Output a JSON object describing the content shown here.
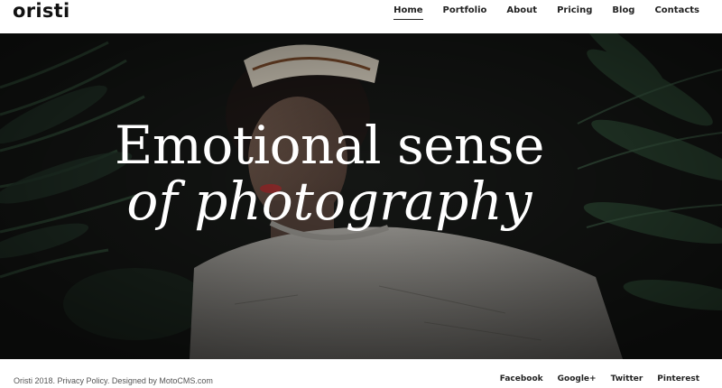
{
  "header": {
    "logo": "oristi",
    "nav": [
      {
        "label": "Home",
        "active": true
      },
      {
        "label": "Portfolio",
        "active": false
      },
      {
        "label": "About",
        "active": false
      },
      {
        "label": "Pricing",
        "active": false
      },
      {
        "label": "Blog",
        "active": false
      },
      {
        "label": "Contacts",
        "active": false
      }
    ]
  },
  "hero": {
    "line1": "Emotional sense",
    "line2": "of photography"
  },
  "footer": {
    "copyright": "Oristi 2018. Privacy Policy. Designed by MotoCMS.com",
    "social": [
      "Facebook",
      "Google+",
      "Twitter",
      "Pinterest"
    ]
  },
  "colors": {
    "background": "#ffffff",
    "hero_dark": "#121412",
    "leaf_green": "#2f4a36",
    "text_dark": "#222222"
  }
}
